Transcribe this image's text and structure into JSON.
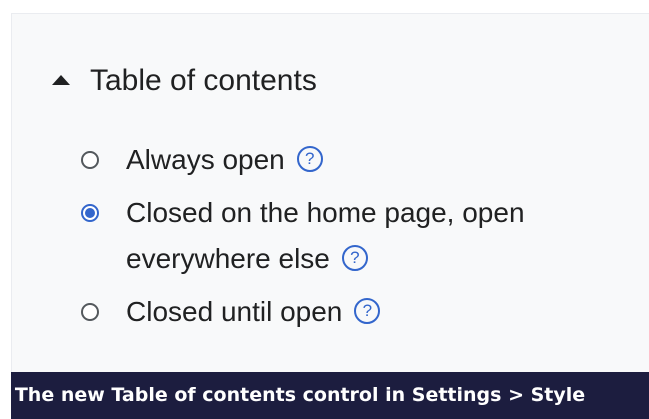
{
  "section": {
    "title": "Table of contents",
    "toggle_icon": "collapse-triangle-icon"
  },
  "options": [
    {
      "label": "Always open",
      "checked": false,
      "help_glyph": "?"
    },
    {
      "label": "Closed on the home page, open everywhere else",
      "checked": true,
      "help_glyph": "?"
    },
    {
      "label": "Closed until open",
      "checked": false,
      "help_glyph": "?"
    }
  ],
  "caption": {
    "text": "The new Table of contents control in Settings > Style"
  },
  "colors": {
    "accent": "#3366cc",
    "panel_background": "#f8f9fa",
    "caption_background": "#1c1d3f",
    "text": "#202122"
  }
}
